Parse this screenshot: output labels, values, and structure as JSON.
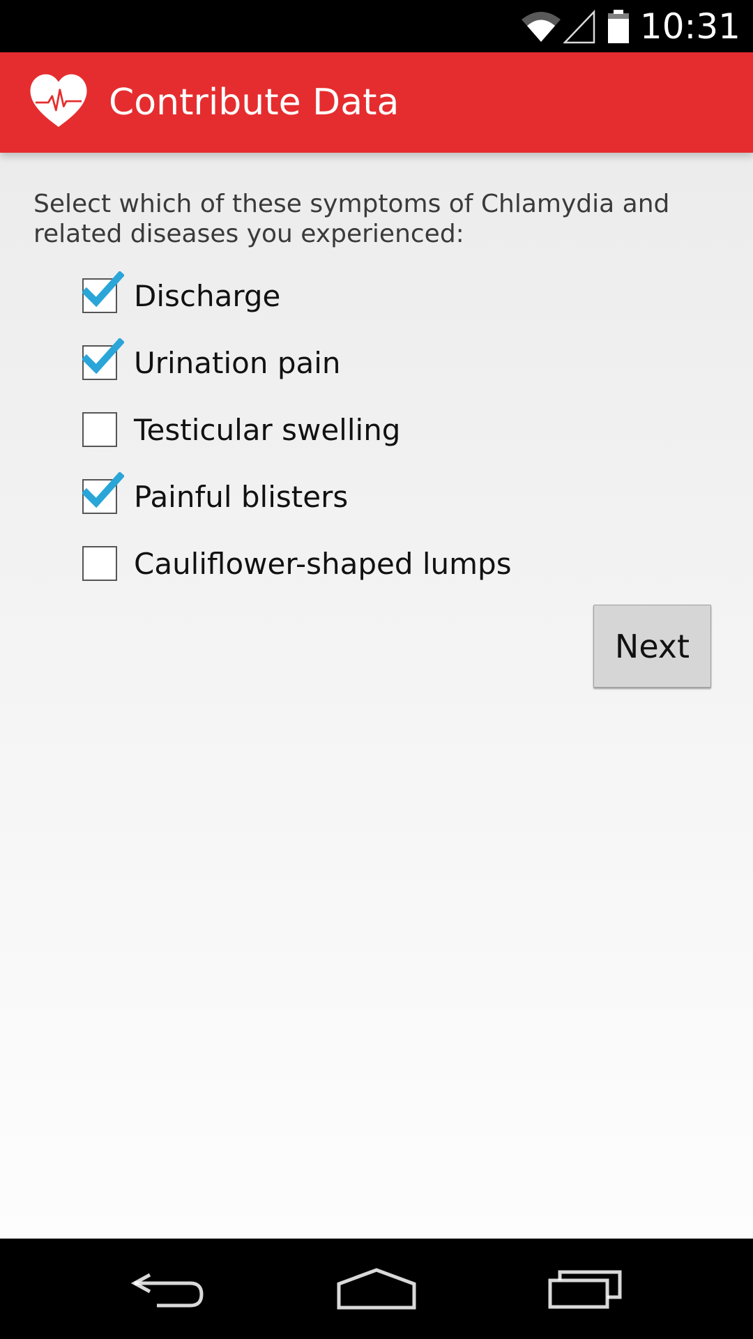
{
  "status_bar": {
    "time": "10:31",
    "icons": [
      "wifi-icon",
      "signal-icon",
      "battery-icon"
    ]
  },
  "action_bar": {
    "title": "Contribute Data",
    "icon": "heart-pulse-icon",
    "color": "#e52d2f"
  },
  "form": {
    "prompt": "Select which of these symptoms of Chlamydia and related diseases you experienced:",
    "options": [
      {
        "label": "Discharge",
        "checked": true
      },
      {
        "label": "Urination pain",
        "checked": true
      },
      {
        "label": "Testicular swelling",
        "checked": false
      },
      {
        "label": "Painful blisters",
        "checked": true
      },
      {
        "label": "Cauliflower-shaped lumps",
        "checked": false
      }
    ],
    "next_label": "Next",
    "check_color": "#2aa5d8"
  },
  "nav_bar": {
    "buttons": [
      "back-icon",
      "home-icon",
      "recents-icon"
    ]
  }
}
